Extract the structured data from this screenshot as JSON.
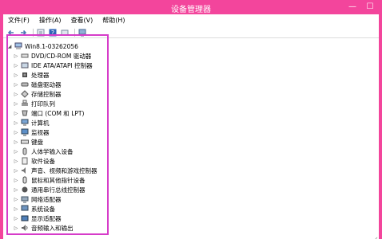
{
  "window": {
    "title": "设备管理器",
    "minimize_glyph": "—",
    "maximize_glyph": "☐",
    "accent_color": "#f3459c",
    "highlight_color": "#d63cc9"
  },
  "menu": {
    "items": [
      "文件(F)",
      "操作(A)",
      "查看(V)",
      "帮助(H)"
    ]
  },
  "toolbar": {
    "buttons": [
      "back-icon",
      "forward-icon",
      "properties-icon",
      "help-icon",
      "update-icon",
      "monitor-icon"
    ]
  },
  "tree": {
    "root": {
      "label": "Win8.1-03262056",
      "icon": "computer-icon"
    },
    "items": [
      {
        "label": "DVD/CD-ROM 驱动器",
        "icon": "disc-drive-icon"
      },
      {
        "label": "IDE ATA/ATAPI 控制器",
        "icon": "ide-controller-icon"
      },
      {
        "label": "处理器",
        "icon": "processor-icon"
      },
      {
        "label": "磁盘驱动器",
        "icon": "disk-drive-icon"
      },
      {
        "label": "存储控制器",
        "icon": "storage-controller-icon"
      },
      {
        "label": "打印队列",
        "icon": "printer-icon"
      },
      {
        "label": "端口 (COM 和 LPT)",
        "icon": "port-icon"
      },
      {
        "label": "计算机",
        "icon": "computer-icon"
      },
      {
        "label": "监视器",
        "icon": "monitor-icon"
      },
      {
        "label": "键盘",
        "icon": "keyboard-icon"
      },
      {
        "label": "人体学输入设备",
        "icon": "hid-icon"
      },
      {
        "label": "软件设备",
        "icon": "software-device-icon"
      },
      {
        "label": "声音、视频和游戏控制器",
        "icon": "sound-icon"
      },
      {
        "label": "鼠标和其他指针设备",
        "icon": "mouse-icon"
      },
      {
        "label": "通用串行总线控制器",
        "icon": "usb-icon"
      },
      {
        "label": "网络适配器",
        "icon": "network-icon"
      },
      {
        "label": "系统设备",
        "icon": "system-device-icon"
      },
      {
        "label": "显示适配器",
        "icon": "display-adapter-icon"
      },
      {
        "label": "音频输入和输出",
        "icon": "audio-icon"
      }
    ]
  }
}
